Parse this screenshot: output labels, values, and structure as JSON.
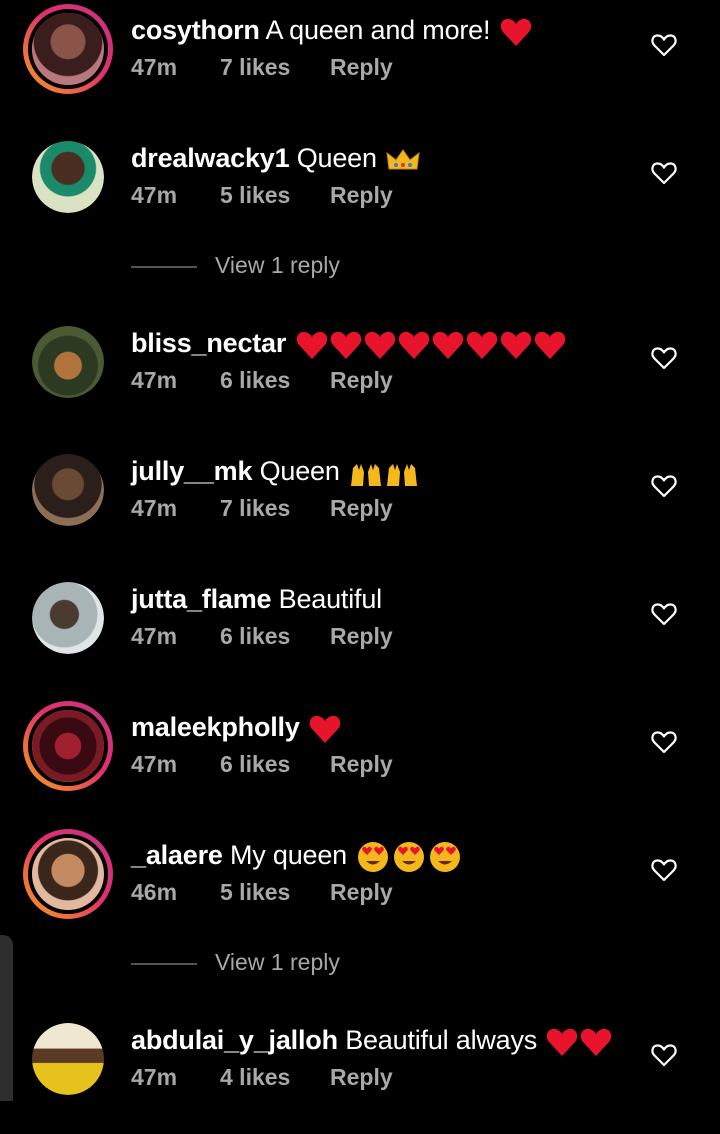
{
  "comments": [
    {
      "username": "cosythorn",
      "text": "A queen and more!",
      "time": "47m",
      "likes": "7 likes",
      "reply": "Reply",
      "emoji": "red-heart",
      "emoji_count": 1,
      "avatar": "#6b3b3b"
    },
    {
      "username": "drealwacky1",
      "text": "Queen",
      "time": "47m",
      "likes": "5 likes",
      "reply": "Reply",
      "emoji": "crown",
      "emoji_count": 1,
      "avatar": "#7a5a44"
    },
    {
      "username": "bliss_nectar",
      "text": "",
      "time": "47m",
      "likes": "6 likes",
      "reply": "Reply",
      "emoji": "red-heart",
      "emoji_count": 8,
      "avatar": "#3d4a2e"
    },
    {
      "username": "jully__mk",
      "text": "Queen",
      "time": "47m",
      "likes": "7 likes",
      "reply": "Reply",
      "emoji": "raised-hands",
      "emoji_count": 2,
      "avatar": "#5a4436"
    },
    {
      "username": "jutta_flame",
      "text": "Beautiful",
      "time": "47m",
      "likes": "6 likes",
      "reply": "Reply",
      "emoji": "",
      "emoji_count": 0,
      "avatar": "#7d8b8f"
    },
    {
      "username": "maleekpholly",
      "text": "",
      "time": "47m",
      "likes": "6 likes",
      "reply": "Reply",
      "emoji": "red-heart",
      "emoji_count": 1,
      "avatar": "#7a1a25"
    },
    {
      "username": "_alaere",
      "text": "My queen",
      "time": "46m",
      "likes": "5 likes",
      "reply": "Reply",
      "emoji": "heart-eyes",
      "emoji_count": 3,
      "avatar": "#a8744e"
    },
    {
      "username": "abdulai_y_jalloh",
      "text": "Beautiful always",
      "time": "47m",
      "likes": "4 likes",
      "reply": "Reply",
      "emoji": "red-heart",
      "emoji_count": 2,
      "avatar": "#d8c23a"
    }
  ],
  "view_replies": [
    "View 1 reply",
    "View 1 reply"
  ],
  "colors": {
    "background": "#000000",
    "meta": "#a8a8a8",
    "heart": "#e8142c",
    "story_ring_start": "#f7a21b",
    "story_ring_end": "#c13584"
  }
}
